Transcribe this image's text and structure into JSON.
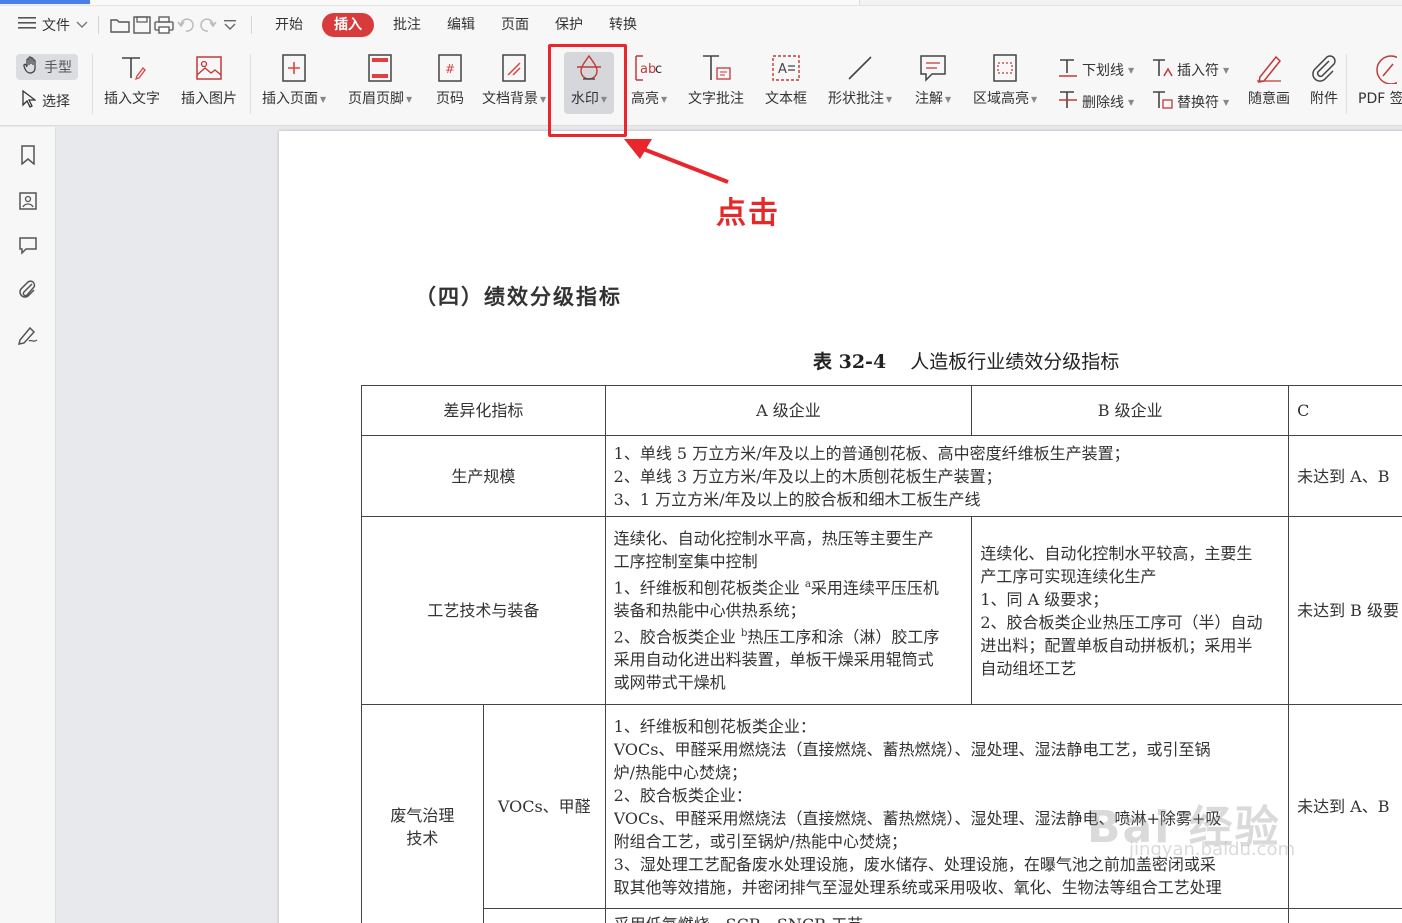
{
  "menubar": {
    "file_label": "文件",
    "tabs": [
      "开始",
      "插入",
      "批注",
      "编辑",
      "页面",
      "保护",
      "转换"
    ],
    "active_tab": "插入"
  },
  "ribbon": {
    "hand": "手型",
    "select": "选择",
    "insert_text": "插入文字",
    "insert_image": "插入图片",
    "insert_page": "插入页面",
    "header_footer": "页眉页脚",
    "page_number": "页码",
    "doc_background": "文档背景",
    "watermark": "水印",
    "highlight": "高亮",
    "text_annotation": "文字批注",
    "textbox": "文本框",
    "shape_annotation": "形状批注",
    "note": "注解",
    "area_highlight": "区域高亮",
    "underline": "下划线",
    "strikethrough": "删除线",
    "insert_mark": "插入符",
    "replace_mark": "替换符",
    "freehand": "随意画",
    "attachment": "附件",
    "pdf_sign": "PDF 签"
  },
  "annotation": {
    "click_label": "点击"
  },
  "document": {
    "heading": "（四）绩效分级指标",
    "table_caption_num": "表 32-4",
    "table_caption_title": "人造板行业绩效分级指标",
    "headers": [
      "差异化指标",
      "A 级企业",
      "B 级企业",
      "C"
    ],
    "row1": {
      "label": "生产规模",
      "lines": [
        "1、单线 5 万立方米/年及以上的普通刨花板、高中密度纤维板生产装置；",
        "2、单线 3 万立方米/年及以上的木质刨花板生产装置；",
        "3、1 万立方米/年及以上的胶合板和细木工板生产线"
      ],
      "c": "未达到 A、B"
    },
    "row2": {
      "label": "工艺技术与装备",
      "a_lines": [
        "连续化、自动化控制水平高，热压等主要生产",
        "工序控制室集中控制",
        "1、纤维板和刨花板类企业",
        "采用连续平压压机",
        "装备和热能中心供热系统；",
        "2、胶合板类企业",
        "热压工序和涂（淋）胶工序",
        "采用自动化进出料装置，单板干燥采用辊筒式",
        "或网带式干燥机"
      ],
      "sup_a": "a",
      "sup_b": "b",
      "b_lines": [
        "连续化、自动化控制水平较高，主要生",
        "产工序可实现连续化生产",
        "1、同 A 级要求；",
        "2、胶合板类企业热压工序可（半）自动",
        "进出料；配置单板自动拼板机；采用半",
        "自动组坯工艺"
      ],
      "c": "未达到 B 级要"
    },
    "row3": {
      "label1": "废气治理",
      "label2": "技术",
      "sub": "VOCs、甲醛",
      "lines": [
        "1、纤维板和刨花板类企业：",
        "VOCs、甲醛采用燃烧法（直接燃烧、蓄热燃烧）、湿处理、湿法静电工艺，或引至锅",
        "炉/热能中心焚烧；",
        "2、胶合板类企业：",
        "VOCs、甲醛采用燃烧法（直接燃烧、蓄热燃烧）、湿处理、湿法静电、喷淋+除雾+吸",
        "附组合工艺，或引至锅炉/热能中心焚烧；",
        "3、湿处理工艺配备废水处理设施，废水储存、处理设施，在曝气池之前加盖密闭或采",
        "取其他等效措施，并密闭排气至湿处理系统或采用吸收、氧化、生物法等组合工艺处理"
      ],
      "c": "未达到 A、B"
    },
    "row4_partial": "采用低氮燃烧、SCR、SNCR 工艺"
  },
  "watermark_text": {
    "main": "Bai 经验",
    "sub": "jingyan.baidu.com"
  }
}
